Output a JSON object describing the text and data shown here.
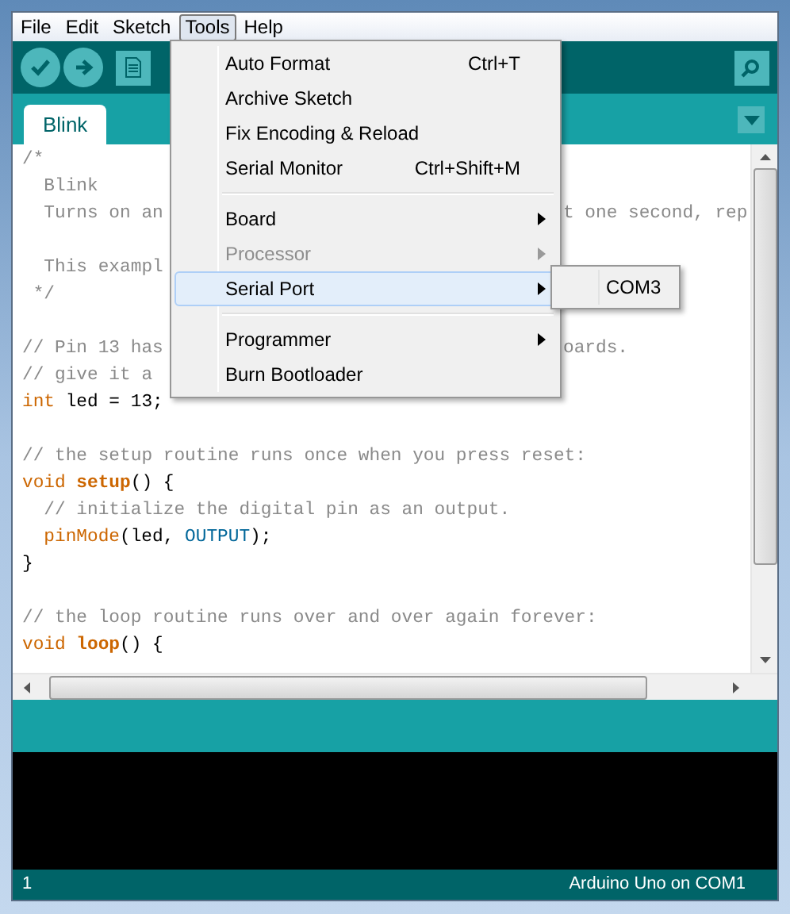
{
  "menu_bar": [
    {
      "label": "File",
      "selected": false
    },
    {
      "label": "Edit",
      "selected": false
    },
    {
      "label": "Sketch",
      "selected": false
    },
    {
      "label": "Tools",
      "selected": true
    },
    {
      "label": "Help",
      "selected": false
    }
  ],
  "tabs": [
    {
      "label": "Blink",
      "selected": true
    }
  ],
  "editor": {
    "lines": [
      {
        "kind": "code",
        "segments": [
          {
            "kind": "comment",
            "text": "/*"
          }
        ]
      },
      {
        "kind": "code",
        "segments": [
          {
            "kind": "comment",
            "text": "  Blink"
          }
        ]
      },
      {
        "kind": "code",
        "segments": [
          {
            "kind": "comment",
            "text": "  Turns on an"
          }
        ],
        "segments_after_menu": [
          {
            "kind": "comment",
            "text": "t one second, rep"
          }
        ]
      },
      {
        "kind": "blank"
      },
      {
        "kind": "code",
        "segments": [
          {
            "kind": "comment",
            "text": "  This exampl"
          }
        ]
      },
      {
        "kind": "code",
        "segments": [
          {
            "kind": "comment",
            "text": " */"
          }
        ]
      },
      {
        "kind": "blank"
      },
      {
        "kind": "code",
        "segments": [
          {
            "kind": "comment",
            "text": "// Pin 13 has"
          }
        ],
        "segments_after_menu": [
          {
            "kind": "comment",
            "text": "oards."
          }
        ]
      },
      {
        "kind": "code",
        "segments": [
          {
            "kind": "comment",
            "text": "// give it a"
          }
        ]
      },
      {
        "kind": "code",
        "segments": [
          {
            "kind": "keyword",
            "text": "int"
          },
          {
            "kind": "plain",
            "text": "led = 13;",
            "space_before": true
          }
        ]
      },
      {
        "kind": "blank"
      },
      {
        "kind": "code",
        "segments": [
          {
            "kind": "comment",
            "text": "// the setup routine runs once when you press reset:"
          }
        ]
      },
      {
        "kind": "code",
        "segments": [
          {
            "kind": "keyword",
            "text": "void"
          },
          {
            "kind": "function",
            "text": "setup",
            "space_before": true
          },
          {
            "kind": "plain",
            "text": "() {"
          }
        ]
      },
      {
        "kind": "code",
        "segments": [
          {
            "kind": "comment",
            "text": "  // initialize the digital pin as an output."
          }
        ]
      },
      {
        "kind": "code",
        "indented": true,
        "segments": [
          {
            "kind": "call",
            "text": "pinMode"
          },
          {
            "kind": "plain",
            "text": "(led,"
          },
          {
            "kind": "constant",
            "text": "OUTPUT",
            "space_before": true
          },
          {
            "kind": "plain",
            "text": ");"
          }
        ]
      },
      {
        "kind": "code",
        "segments": [
          {
            "kind": "plain",
            "text": "}"
          }
        ]
      },
      {
        "kind": "blank"
      },
      {
        "kind": "code",
        "segments": [
          {
            "kind": "comment",
            "text": "// the loop routine runs over and over again forever:"
          }
        ]
      },
      {
        "kind": "code",
        "segments": [
          {
            "kind": "keyword",
            "text": "void"
          },
          {
            "kind": "function",
            "text": "loop",
            "space_before": true
          },
          {
            "kind": "plain",
            "text": "() {"
          }
        ]
      }
    ]
  },
  "tools_menu": [
    {
      "kind": "item",
      "label": "Auto Format",
      "shortcut": "Ctrl+T",
      "submenu": false,
      "disabled": false,
      "selected": false
    },
    {
      "kind": "item",
      "label": "Archive Sketch",
      "submenu": false,
      "disabled": false,
      "selected": false
    },
    {
      "kind": "item",
      "label": "Fix Encoding & Reload",
      "submenu": false,
      "disabled": false,
      "selected": false
    },
    {
      "kind": "item",
      "label": "Serial Monitor",
      "shortcut": "Ctrl+Shift+M",
      "submenu": false,
      "disabled": false,
      "selected": false
    },
    {
      "kind": "separator"
    },
    {
      "kind": "item",
      "label": "Board",
      "submenu": true,
      "disabled": false,
      "selected": false
    },
    {
      "kind": "item",
      "label": "Processor",
      "submenu": true,
      "disabled": true,
      "selected": false
    },
    {
      "kind": "item",
      "label": "Serial Port",
      "submenu": true,
      "disabled": false,
      "selected": true
    },
    {
      "kind": "separator"
    },
    {
      "kind": "item",
      "label": "Programmer",
      "submenu": true,
      "disabled": false,
      "selected": false
    },
    {
      "kind": "item",
      "label": "Burn Bootloader",
      "submenu": false,
      "disabled": false,
      "selected": false
    }
  ],
  "serial_port_submenu": [
    {
      "label": "COM3"
    }
  ],
  "status_bar": {
    "line": "1",
    "board": "Arduino Uno on COM1"
  }
}
